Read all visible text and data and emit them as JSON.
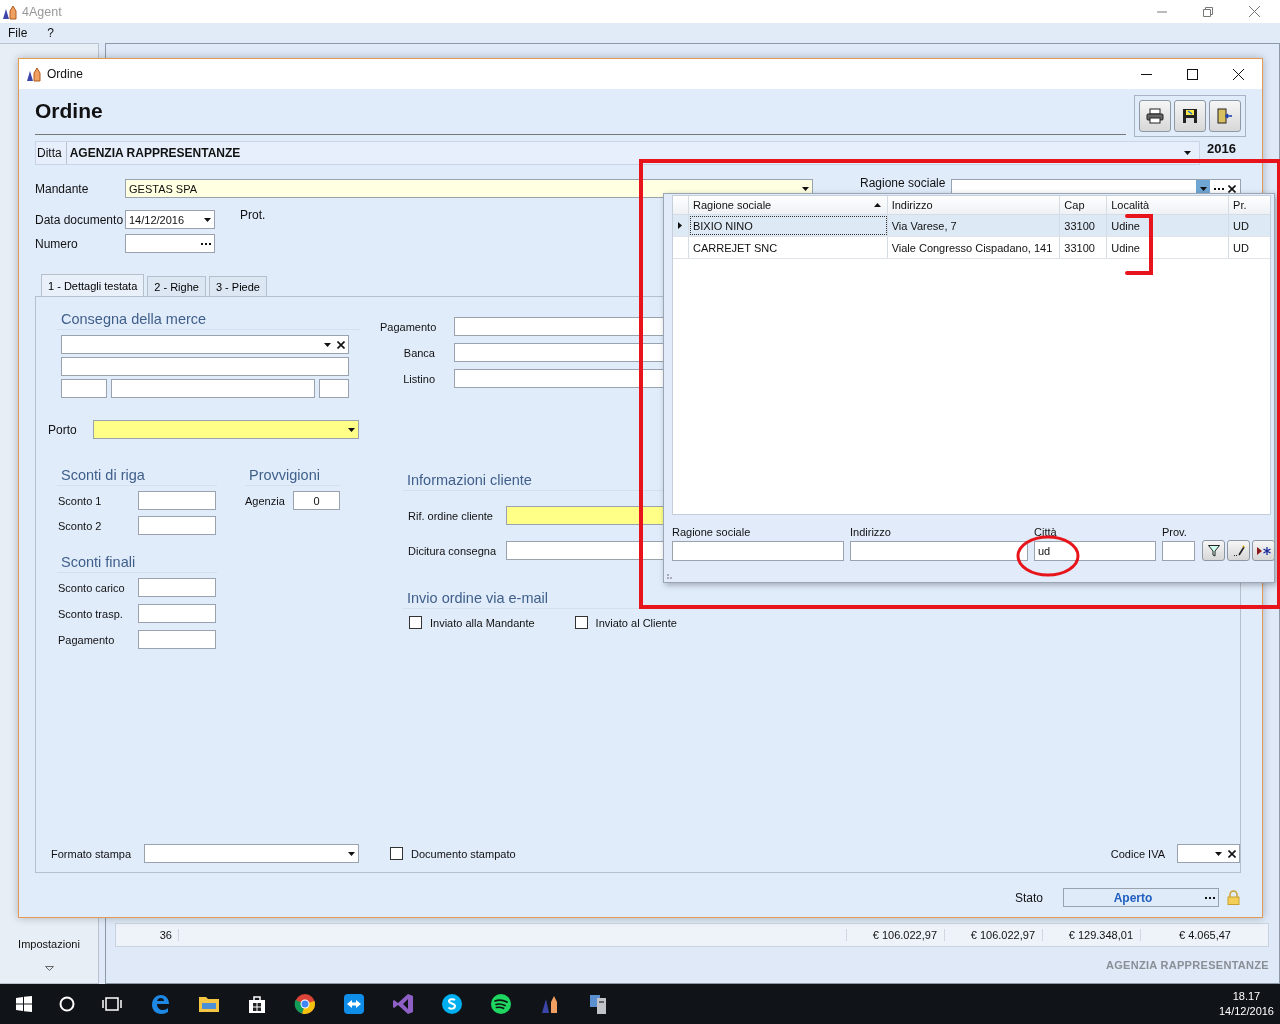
{
  "app": {
    "title": "4Agent",
    "menu": [
      "File",
      "?"
    ],
    "sidebar_item": "Impostazioni",
    "company": "AGENZIA RAPPRESENTANZE"
  },
  "totals_row": {
    "count": "36",
    "amounts": [
      "€ 106.022,97",
      "€ 106.022,97",
      "€ 129.348,01",
      "€ 4.065,47"
    ]
  },
  "dialog": {
    "title": "Ordine",
    "heading": "Ordine",
    "ditta": {
      "label": "Ditta",
      "value": "AGENZIA RAPPRESENTANZE",
      "year": "2016"
    },
    "mandante": {
      "label": "Mandante",
      "value": "GESTAS SPA"
    },
    "cliente": {
      "label": "Ragione sociale",
      "open": true
    },
    "data_documento": {
      "label": "Data documento",
      "value": "14/12/2016"
    },
    "prot": "Prot.",
    "numero": {
      "label": "Numero"
    },
    "tabs": [
      {
        "label": "1 - Dettagli testata",
        "selected": true
      },
      {
        "label": "2 - Righe",
        "selected": false
      },
      {
        "label": "3 - Piede",
        "selected": false
      }
    ],
    "consegna": {
      "title": "Consegna della merce"
    },
    "porto": {
      "label": "Porto",
      "required": true
    },
    "pagamento_fields": [
      {
        "label": "Pagamento"
      },
      {
        "label": "Banca"
      },
      {
        "label": "Listino"
      }
    ],
    "sconti_riga": {
      "title": "Sconti di riga",
      "fields": [
        {
          "label": "Sconto 1"
        },
        {
          "label": "Sconto 2"
        }
      ]
    },
    "provvigioni": {
      "title": "Provvigioni",
      "fields": [
        {
          "label": "Agenzia",
          "value": "0"
        }
      ]
    },
    "sconti_finali": {
      "title": "Sconti finali",
      "fields": [
        {
          "label": "Sconto carico"
        },
        {
          "label": "Sconto trasp."
        },
        {
          "label": "Pagamento"
        }
      ]
    },
    "informazioni_cliente": {
      "title": "Informazioni cliente",
      "fields": [
        {
          "label": "Rif. ordine cliente",
          "required": true
        },
        {
          "label": "Dicitura consegna",
          "required": false
        }
      ]
    },
    "invio_email": {
      "title": "Invio ordine via e-mail",
      "options": [
        {
          "label": "Inviato alla Mandante",
          "checked": false
        },
        {
          "label": "Inviato al Cliente",
          "checked": false
        }
      ]
    },
    "formato_stampa": {
      "label": "Formato stampa"
    },
    "documento_stampato": {
      "label": "Documento stampato",
      "checked": false
    },
    "codice_iva": {
      "label": "Codice IVA"
    },
    "stato": {
      "label": "Stato",
      "value": "Aperto"
    }
  },
  "lookup": {
    "columns": [
      {
        "label": "Ragione sociale",
        "sorted": true
      },
      {
        "label": "Indirizzo"
      },
      {
        "label": "Cap"
      },
      {
        "label": "Località"
      },
      {
        "label": "Pr."
      }
    ],
    "rows": [
      {
        "cells": [
          "BIXIO NINO",
          "Via Varese, 7",
          "33100",
          "Udine",
          "UD"
        ],
        "selected": true
      },
      {
        "cells": [
          "CARREJET SNC",
          "Viale Congresso Cispadano, 141",
          "33100",
          "Udine",
          "UD"
        ],
        "selected": false
      }
    ],
    "filters": [
      {
        "label": "Ragione sociale"
      },
      {
        "label": "Indirizzo"
      },
      {
        "label": "Città",
        "value": "ud"
      },
      {
        "label": "Prov."
      }
    ]
  },
  "taskbar": {
    "time": "18.17",
    "date": "14/12/2016"
  }
}
